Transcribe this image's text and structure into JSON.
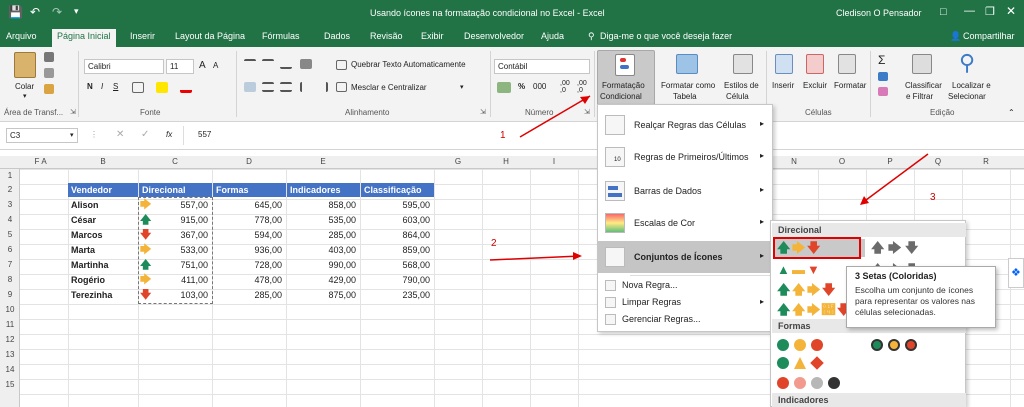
{
  "titlebar": {
    "title": "Usando ícones na formatação condicional no Excel  -  Excel",
    "user": "Cledison O Pensador",
    "qat_icons": [
      "save-icon",
      "undo-icon",
      "redo-icon",
      "customize-icon"
    ],
    "window_controls": [
      "ribbon-display-icon",
      "minimize-icon",
      "restore-icon",
      "close-icon"
    ]
  },
  "tabs": [
    "Arquivo",
    "Página Inicial",
    "Inserir",
    "Layout da Página",
    "Fórmulas",
    "Dados",
    "Revisão",
    "Exibir",
    "Desenvolvedor",
    "Ajuda"
  ],
  "active_tab": "Página Inicial",
  "tellme": "Diga-me o que você deseja fazer",
  "share": "Compartilhar",
  "ribbon": {
    "clipboard": {
      "paste": "Colar",
      "label": "Área de Transf..."
    },
    "font": {
      "name": "Calibri",
      "size": "11",
      "bold": "N",
      "italic": "I",
      "underline": "S",
      "label": "Fonte",
      "grow": "A",
      "shrink": "A"
    },
    "alignment": {
      "wrap": "Quebrar Texto Automaticamente",
      "merge": "Mesclar e Centralizar",
      "label": "Alinhamento"
    },
    "number": {
      "format": "Contábil",
      "label": "Número",
      "percent": "%",
      "thousands": "000",
      "inc_dec": ",00 ,0",
      "dec_dec": ",00 ,0"
    },
    "styles": {
      "cond_format_l1": "Formatação",
      "cond_format_l2": "Condicional",
      "format_table_l1": "Formatar como",
      "format_table_l2": "Tabela",
      "cell_styles_l1": "Estilos de",
      "cell_styles_l2": "Célula"
    },
    "cells": {
      "insert": "Inserir",
      "delete": "Excluir",
      "format": "Formatar",
      "label": "Células"
    },
    "editing": {
      "sort_l1": "Classificar",
      "sort_l2": "e Filtrar",
      "find_l1": "Localizar e",
      "find_l2": "Selecionar",
      "label": "Edição"
    }
  },
  "formula_bar": {
    "name_box": "C3",
    "fx": "fx",
    "value": "557"
  },
  "columns": [
    "A",
    "B",
    "C",
    "D",
    "E",
    "F",
    "G",
    "H",
    "I",
    "",
    "N",
    "O",
    "P",
    "Q",
    "R"
  ],
  "rows": [
    "1",
    "2",
    "3",
    "4",
    "5",
    "6",
    "7",
    "8",
    "9",
    "10",
    "11",
    "12",
    "13",
    "14",
    "15"
  ],
  "table": {
    "headers": [
      "Vendedor",
      "Direcional",
      "Formas",
      "Indicadores",
      "Classificação"
    ],
    "rows": [
      {
        "name": "Alison",
        "dir": "557,00",
        "icon": "right",
        "formas": "645,00",
        "ind": "858,00",
        "cls": "595,00"
      },
      {
        "name": "César",
        "dir": "915,00",
        "icon": "up",
        "formas": "778,00",
        "ind": "535,00",
        "cls": "603,00"
      },
      {
        "name": "Marcos",
        "dir": "367,00",
        "icon": "down",
        "formas": "594,00",
        "ind": "285,00",
        "cls": "864,00"
      },
      {
        "name": "Marta",
        "dir": "533,00",
        "icon": "right",
        "formas": "936,00",
        "ind": "403,00",
        "cls": "859,00"
      },
      {
        "name": "Martinha",
        "dir": "751,00",
        "icon": "up",
        "formas": "728,00",
        "ind": "990,00",
        "cls": "568,00"
      },
      {
        "name": "Rogério",
        "dir": "411,00",
        "icon": "right",
        "formas": "478,00",
        "ind": "429,00",
        "cls": "790,00"
      },
      {
        "name": "Terezinha",
        "dir": "103,00",
        "icon": "down",
        "formas": "285,00",
        "ind": "875,00",
        "cls": "235,00"
      }
    ]
  },
  "cf_menu": {
    "items": [
      "Realçar Regras das Células",
      "Regras de Primeiros/Últimos",
      "Barras de Dados",
      "Escalas de Cor",
      "Conjuntos de Ícones"
    ],
    "small_items": [
      "Nova Regra...",
      "Limpar Regras",
      "Gerenciar Regras..."
    ],
    "top10_badge": "10"
  },
  "icon_sets": {
    "directional": "Direcional",
    "shapes": "Formas",
    "indicators": "Indicadores"
  },
  "tooltip": {
    "title": "3 Setas (Coloridas)",
    "body": "Escolha um conjunto de ícones para representar os valores nas células selecionadas."
  },
  "callouts": [
    "1",
    "2",
    "3"
  ],
  "colors": {
    "excel_green": "#217346",
    "table_header": "#4472c4",
    "arrow_green": "#1e8c5a",
    "arrow_yellow": "#f4b43a",
    "arrow_red": "#e0452a",
    "highlight_red": "#e00000",
    "gray_arrow": "#6b6b6b"
  }
}
